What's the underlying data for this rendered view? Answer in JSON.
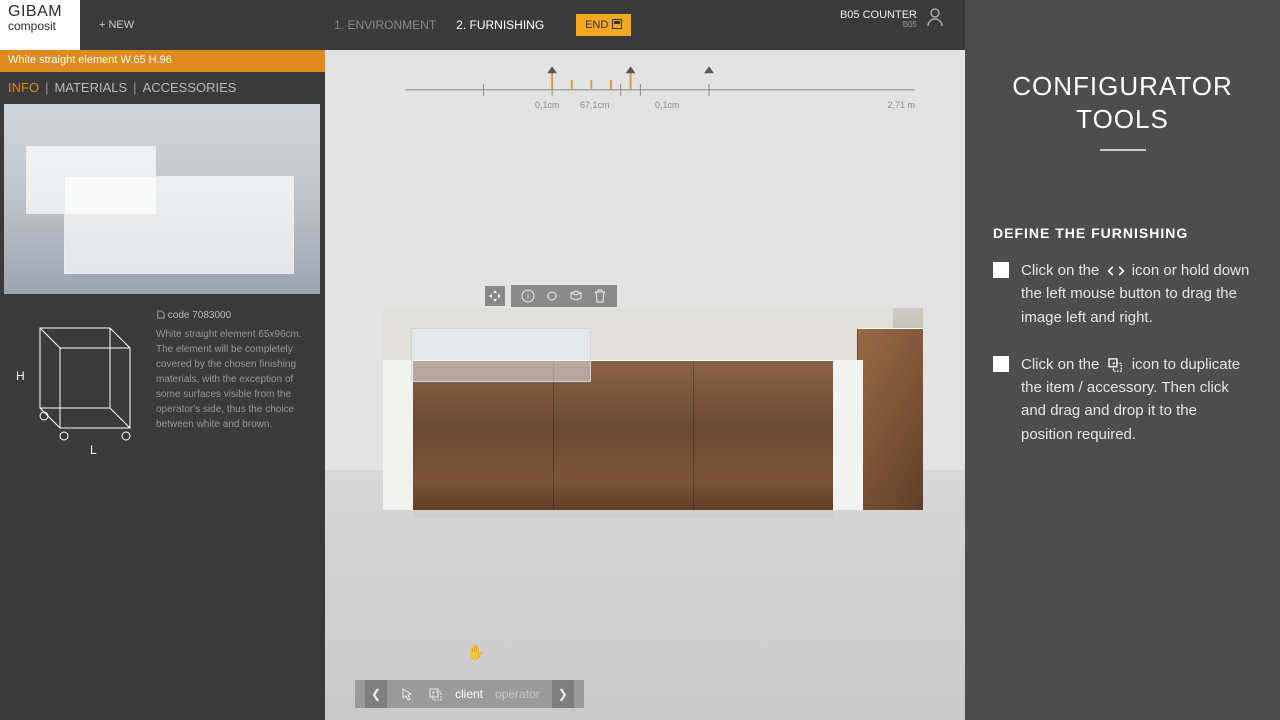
{
  "header": {
    "brand_line1": "GIBAM",
    "brand_line2": "composit",
    "add_label": "+ NEW",
    "step1": "1. ENVIRONMENT",
    "step2": "2. FURNISHING",
    "end_label": "END",
    "user_name": "B05 COUNTER",
    "user_code": "B05"
  },
  "title_strip": "White straight element W.65 H.96",
  "panel": {
    "tab_info": "INFO",
    "tab_materials": "MATERIALS",
    "tab_accessories": "ACCESSORIES",
    "code_label": "code 7083000",
    "description": "White straight element 65x96cm. The element will be completely covered by the chosen finishing materials, with the exception of some surfaces visible from the operator's side, thus the choice between white and brown.",
    "dim_h": "H",
    "dim_l": "L"
  },
  "ruler": {
    "left": "0,1cm",
    "center": "67,1cm",
    "right": "0,1cm",
    "total": "2,71 m"
  },
  "bottom": {
    "mode_client": "client",
    "mode_operator": "operator"
  },
  "help": {
    "title1": "CONFIGURATOR",
    "title2": "TOOLS",
    "section": "DEFINE THE FURNISHING",
    "tip1a": "Click on the ",
    "tip1b": " icon or hold down the left mouse button to drag the image left and right.",
    "tip2a": "Click on the ",
    "tip2b": " icon to duplicate the item / accessory. Then click and drag and drop it to the position required."
  }
}
